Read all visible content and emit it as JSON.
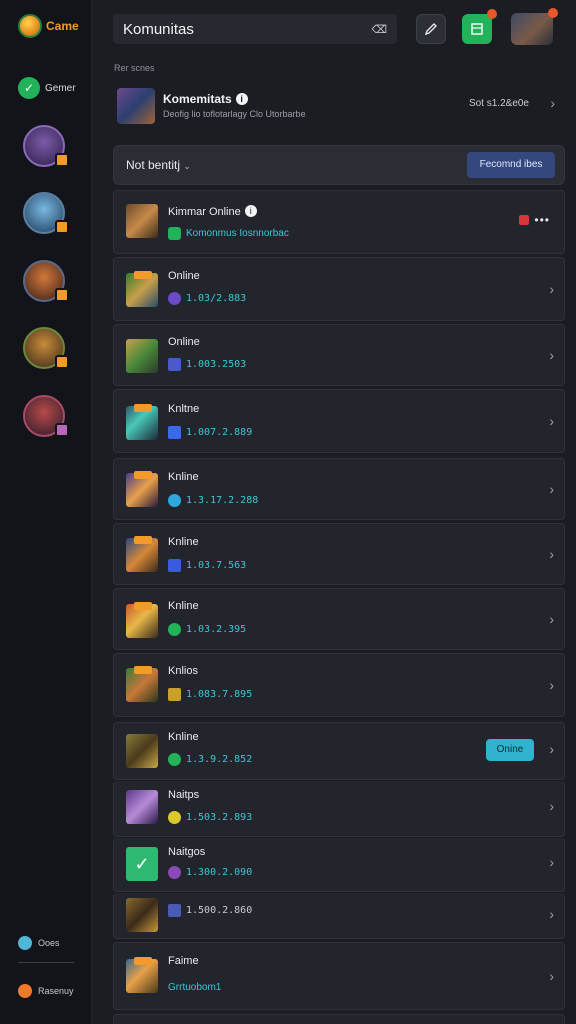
{
  "sidebar": {
    "brand_name": "Came",
    "gamer_label": "Gemer",
    "bottom_label_1": "Ooes",
    "bottom_label_2": "Rasenuy"
  },
  "topbar": {
    "search_value": "Komunitas",
    "clear_glyph": "⌫"
  },
  "section_label": "Rer scnes",
  "community": {
    "title": "Komemitats",
    "subtitle": "Deofig lio toflotarlagy Clo Utorbarbe",
    "right_text": "Sot s1.2&e0e"
  },
  "filter": {
    "label": "Not bentitj",
    "recommend_label": "Fecomnd ibes"
  },
  "rows": [
    {
      "title": "Kimmar Online",
      "status": "Komonmus Iosnnorbac",
      "has_info": true,
      "has_menu": true
    },
    {
      "title": "Online",
      "status": "1.03/2.883"
    },
    {
      "title": "Online",
      "status": "1.003.2503"
    },
    {
      "title": "Knltne",
      "status": "1.007.2.889"
    },
    {
      "title": "Knline",
      "status": "1.3.17.2.288"
    },
    {
      "title": "Knline",
      "status": "1.03.7.563"
    },
    {
      "title": "Knline",
      "status": "1.03.2.395"
    },
    {
      "title": "Knlios",
      "status": "1.083.7.895"
    },
    {
      "title": "Knline",
      "status": "1.3.9.2.852",
      "button": "Onine"
    },
    {
      "title": "Naitps",
      "status": "1.503.2.893"
    },
    {
      "title": "Naitgos",
      "status": "1.300.2.090"
    },
    {
      "title": "",
      "status": "1.500.2.860"
    },
    {
      "title": "Faime",
      "status": "Grrtuobom1"
    }
  ],
  "colors": {
    "accent_green": "#22b35a",
    "accent_orange": "#f39a2b",
    "status_cyan": "#3ec6d4",
    "button_blue": "#35487e"
  }
}
